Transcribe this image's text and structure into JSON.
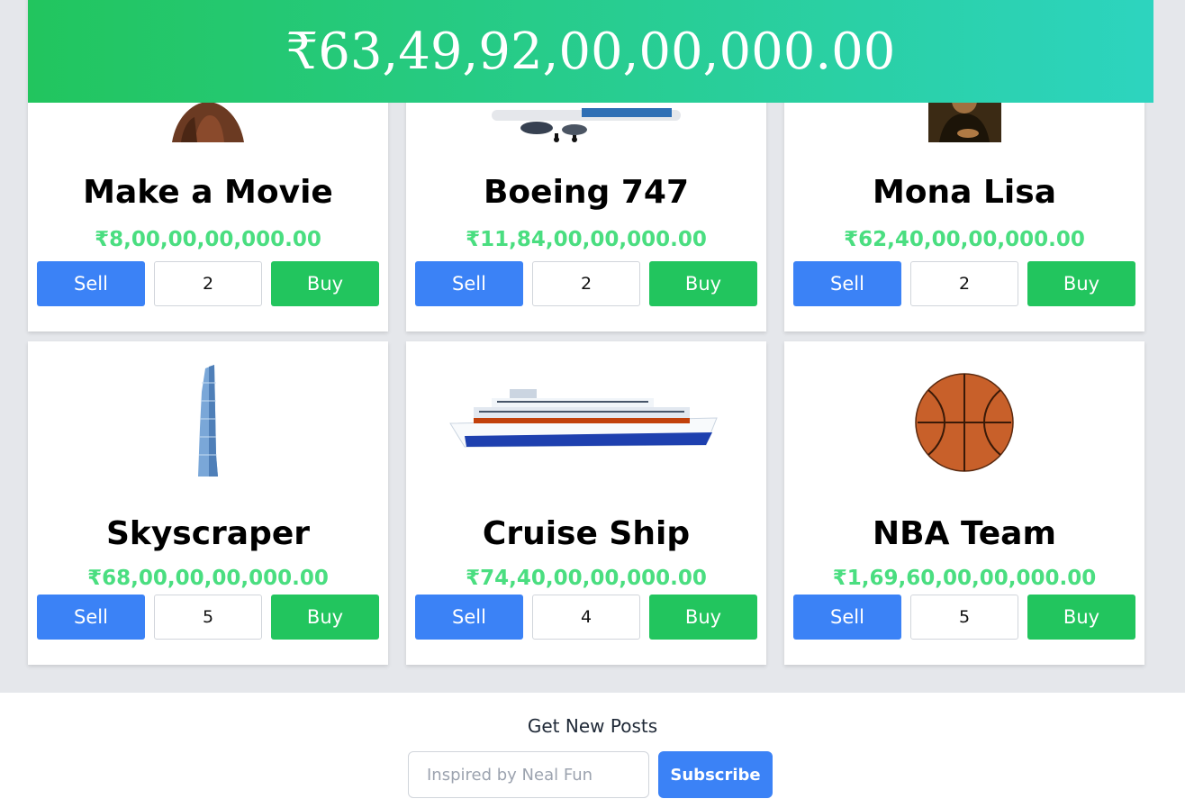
{
  "header": {
    "total_money": "₹63,49,92,00,00,000.00",
    "gradient_start": "#22c55e",
    "gradient_end": "#2dd4bf"
  },
  "colors": {
    "sell": "#3b82f6",
    "buy": "#22c55e",
    "price": "#4ade80"
  },
  "items": [
    {
      "name": "Make a Movie",
      "price": "₹8,00,00,00,000.00",
      "quantity": "2",
      "sell_label": "Sell",
      "buy_label": "Buy",
      "icon": "movie-actor-image"
    },
    {
      "name": "Boeing 747",
      "price": "₹11,84,00,00,000.00",
      "quantity": "2",
      "sell_label": "Sell",
      "buy_label": "Buy",
      "icon": "airplane-image"
    },
    {
      "name": "Mona Lisa",
      "price": "₹62,40,00,00,000.00",
      "quantity": "2",
      "sell_label": "Sell",
      "buy_label": "Buy",
      "icon": "painting-image"
    },
    {
      "name": "Skyscraper",
      "price": "₹68,00,00,00,000.00",
      "quantity": "5",
      "sell_label": "Sell",
      "buy_label": "Buy",
      "icon": "skyscraper-image"
    },
    {
      "name": "Cruise Ship",
      "price": "₹74,40,00,00,000.00",
      "quantity": "4",
      "sell_label": "Sell",
      "buy_label": "Buy",
      "icon": "cruise-ship-image"
    },
    {
      "name": "NBA Team",
      "price": "₹1,69,60,00,00,000.00",
      "quantity": "5",
      "sell_label": "Sell",
      "buy_label": "Buy",
      "icon": "basketball-image"
    }
  ],
  "footer": {
    "heading": "Get New Posts",
    "email_placeholder": "Inspired by Neal Fun",
    "subscribe_label": "Subscribe"
  }
}
